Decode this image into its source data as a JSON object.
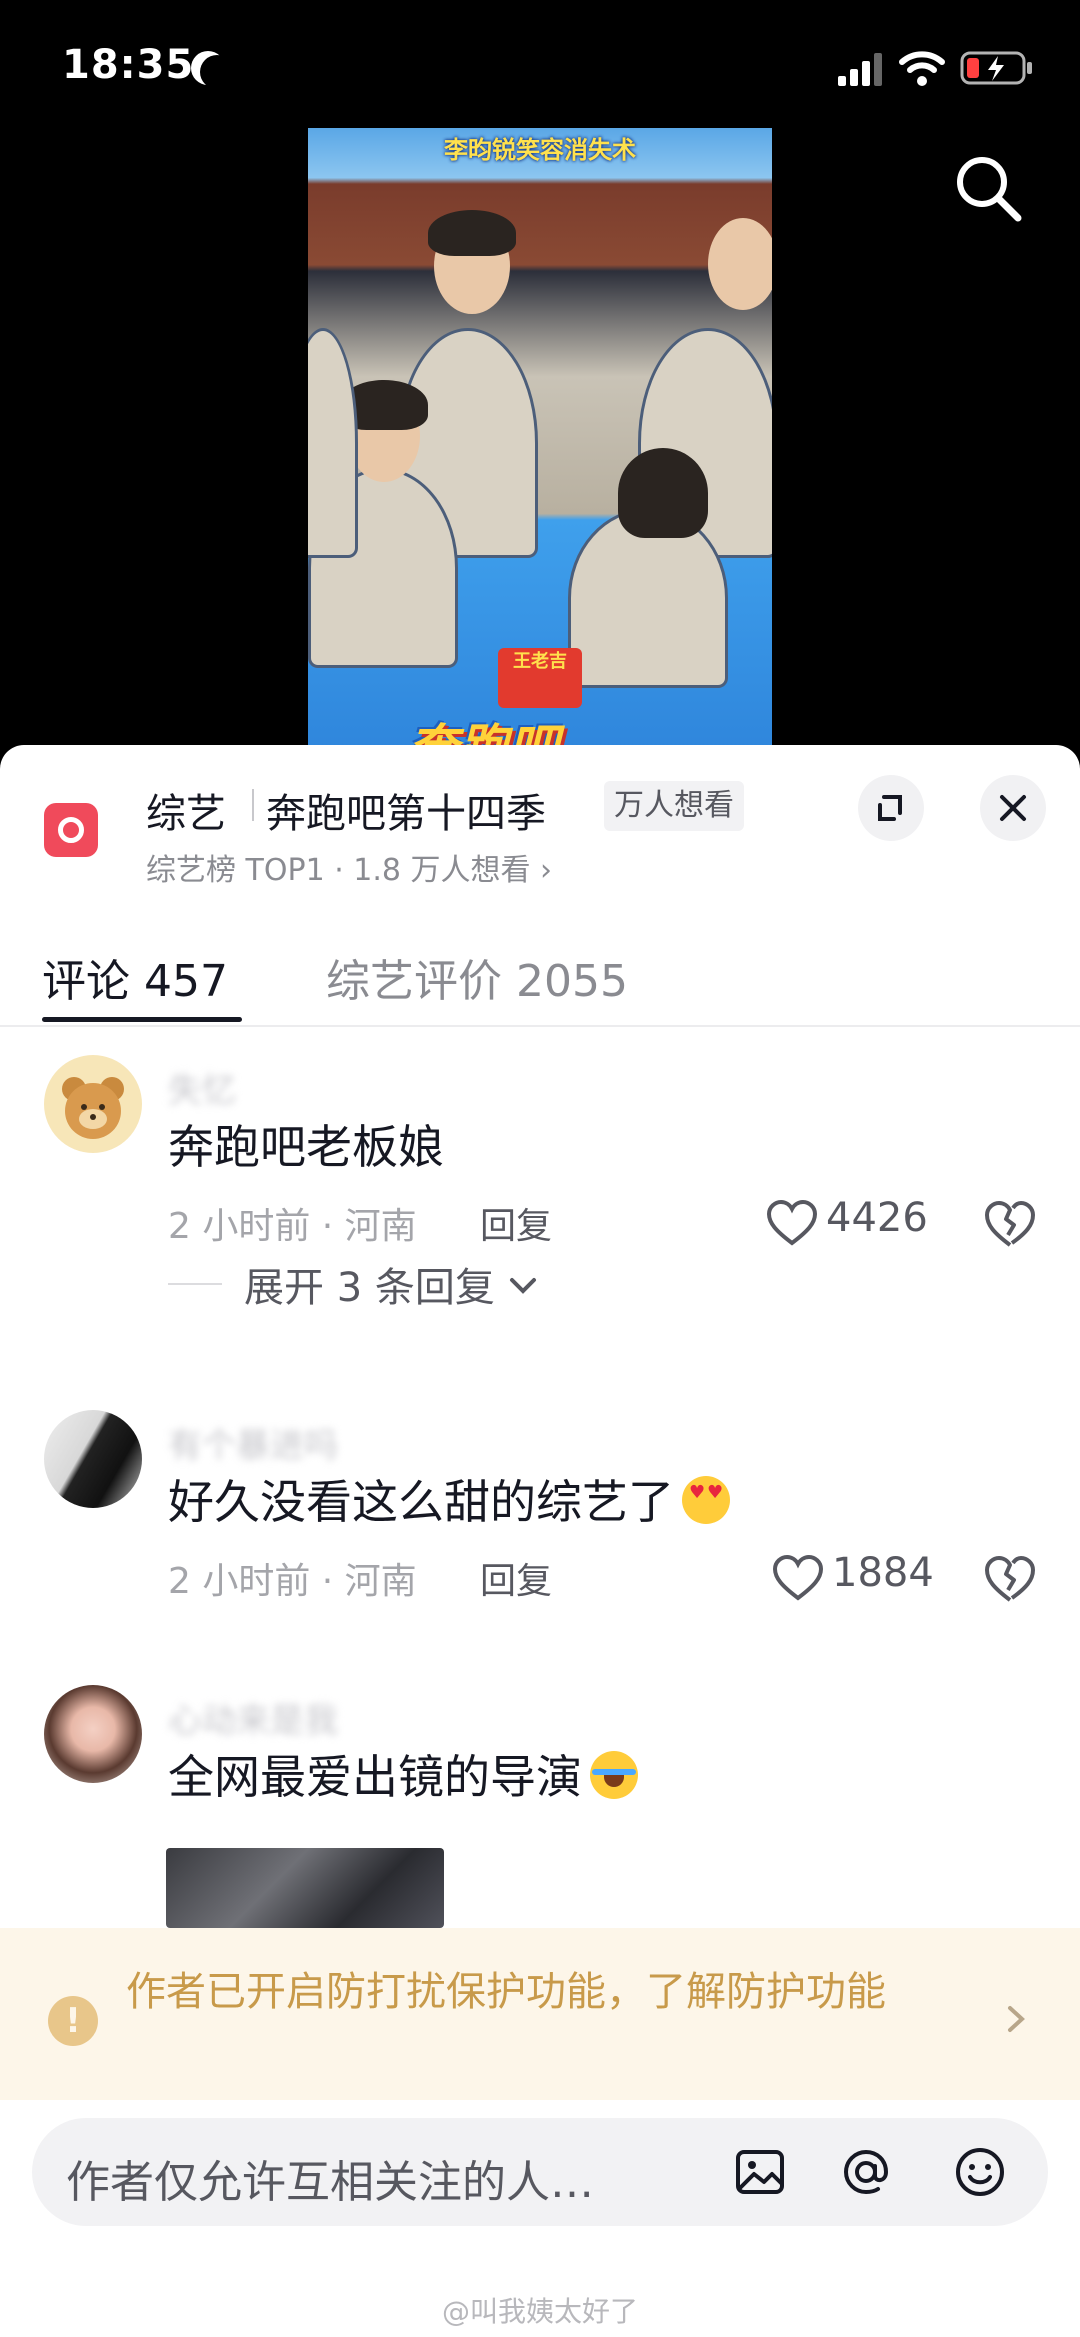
{
  "status_bar": {
    "time": "18:35"
  },
  "video": {
    "caption": "李昀锐笑容消失术",
    "sponsor_label": "王老吉",
    "show_logo": "奔跑吧"
  },
  "header": {
    "category": "综艺",
    "show_title": "奔跑吧第十四季",
    "badge": "万人想看",
    "subtitle": "综艺榜 TOP1 · 1.8 万人想看 ›"
  },
  "tabs": [
    {
      "label": "评论 457",
      "active": true
    },
    {
      "label": "综艺评价 2055",
      "active": false
    }
  ],
  "comments": [
    {
      "username": "失忆",
      "text": "奔跑吧老板娘",
      "emoji": "",
      "meta": "2 小时前 · 河南",
      "reply_label": "回复",
      "likes": "4426",
      "expand_label": "展开 3 条回复"
    },
    {
      "username": "有个暴进吗",
      "text": "好久没看这么甜的综艺了",
      "emoji": "heart-eyes",
      "meta": "2 小时前 · 河南",
      "reply_label": "回复",
      "likes": "1884"
    },
    {
      "username": "心动来是我",
      "text": "全网最爱出镜的导演",
      "emoji": "crying"
    }
  ],
  "notice": {
    "text": "作者已开启防打扰保护功能，了解防护功能"
  },
  "input": {
    "placeholder": "作者仅允许互相关注的人…"
  },
  "watermark": "@叫我姨太好了",
  "colors": {
    "accent": "#f04a5b",
    "notice_bg": "#fdf6e9",
    "notice_text": "#c89a4a"
  }
}
